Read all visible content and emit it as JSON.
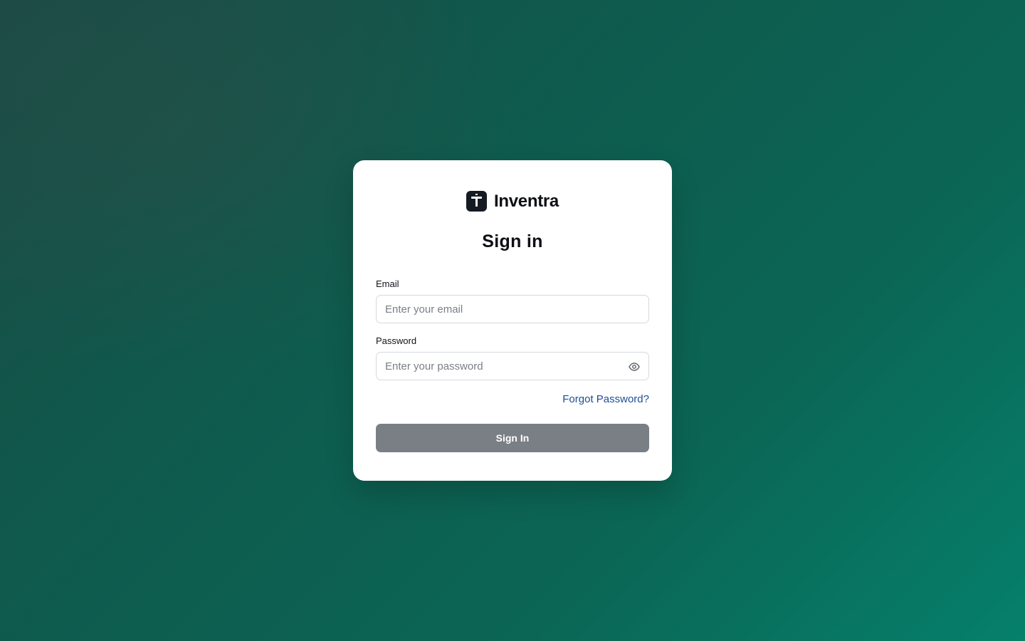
{
  "brand": {
    "name": "Inventra",
    "logo_icon": "letter-t-logo-icon"
  },
  "form": {
    "title": "Sign in",
    "email": {
      "label": "Email",
      "placeholder": "Enter your email",
      "value": ""
    },
    "password": {
      "label": "Password",
      "placeholder": "Enter your password",
      "value": "",
      "toggle_icon": "eye-icon"
    },
    "forgot_label": "Forgot Password?",
    "submit_label": "Sign In"
  },
  "colors": {
    "background_start": "#1b4a44",
    "background_end": "#05806b",
    "card": "#ffffff",
    "link": "#1d4e95",
    "button_disabled": "#7a7e85",
    "logo_bg": "#161a22"
  }
}
